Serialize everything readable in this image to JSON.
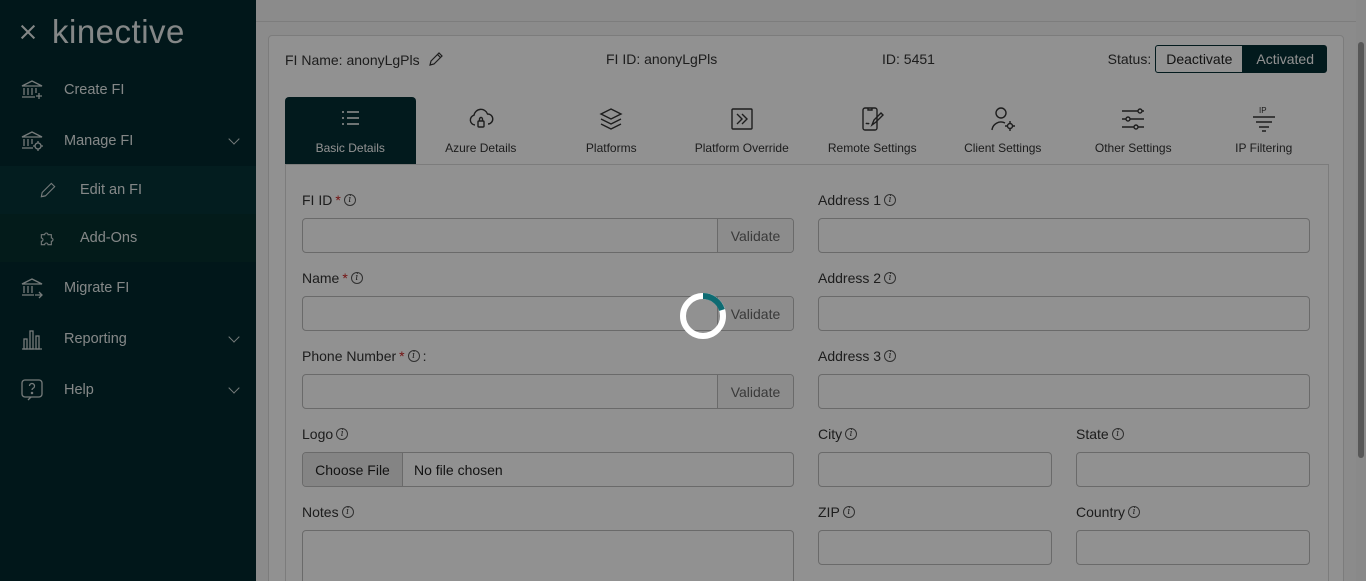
{
  "sidebar": {
    "logo": "kinective",
    "items": [
      {
        "label": "Create FI",
        "icon": "bank-plus-icon"
      },
      {
        "label": "Manage FI",
        "icon": "bank-gear-icon"
      },
      {
        "label": "Edit an FI",
        "icon": "pencil-icon"
      },
      {
        "label": "Add-Ons",
        "icon": "puzzle-icon"
      },
      {
        "label": "Migrate FI",
        "icon": "bank-arrow-icon"
      },
      {
        "label": "Reporting",
        "icon": "bar-chart-icon"
      },
      {
        "label": "Help",
        "icon": "question-icon"
      }
    ]
  },
  "header": {
    "fi_name": "FI Name: anonyLgPls",
    "fi_id": "FI ID: anonyLgPls",
    "id": "ID: 5451",
    "status_label": "Status:",
    "deactivate": "Deactivate",
    "activated": "Activated"
  },
  "tabs": [
    {
      "label": "Basic Details",
      "icon": "list-icon",
      "active": true
    },
    {
      "label": "Azure Details",
      "icon": "cloud-lock-icon"
    },
    {
      "label": "Platforms",
      "icon": "layers-icon"
    },
    {
      "label": "Platform Override",
      "icon": "override-icon"
    },
    {
      "label": "Remote Settings",
      "icon": "phone-edit-icon"
    },
    {
      "label": "Client Settings",
      "icon": "user-gear-icon"
    },
    {
      "label": "Other Settings",
      "icon": "sliders-icon"
    },
    {
      "label": "IP Filtering",
      "icon": "ip-filter-icon"
    }
  ],
  "form": {
    "fi_id": {
      "label": "FI ID",
      "value": "",
      "validate": "Validate"
    },
    "name": {
      "label": "Name",
      "value": "",
      "validate": "Validate"
    },
    "phone": {
      "label": "Phone Number",
      "suffix": ":",
      "value": "",
      "validate": "Validate"
    },
    "logo": {
      "label": "Logo",
      "button": "Choose File",
      "file": "No file chosen"
    },
    "notes": {
      "label": "Notes"
    },
    "address1": {
      "label": "Address 1"
    },
    "address2": {
      "label": "Address 2"
    },
    "address3": {
      "label": "Address 3"
    },
    "city": {
      "label": "City"
    },
    "state": {
      "label": "State"
    },
    "zip": {
      "label": "ZIP"
    },
    "country": {
      "label": "Country"
    },
    "required_mark": "*",
    "info_glyph": "i"
  },
  "colors": {
    "sidebar_bg": "#032a2e",
    "accent": "#042e33",
    "spinner": "#0e6b72"
  }
}
